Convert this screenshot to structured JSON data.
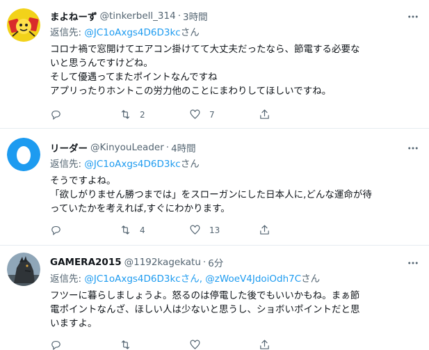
{
  "tweets": [
    {
      "display_name": "まよねーず",
      "handle": "@tinkerbell_314",
      "time": "3時間",
      "reply_prefix": "返信先: ",
      "reply_mentions": "@JC1oAxgs4D6D3kc",
      "reply_suffix": "さん",
      "lines": [
        "コロナ禍で窓開けてエアコン掛けてて大丈夫だったなら、節電する必要な",
        "いと思うんですけどね。",
        "そして優遇ってまたポイントなんですね",
        "アプリったりホントこの労力他のことにまわりしてほしいですね。"
      ],
      "replies": "",
      "retweets": "2",
      "likes": "7",
      "avatar_icon": "yellow-character-avatar-icon"
    },
    {
      "display_name": "リーダー",
      "handle": "@KinyouLeader",
      "time": "4時間",
      "reply_prefix": "返信先: ",
      "reply_mentions": "@JC1oAxgs4D6D3kc",
      "reply_suffix": "さん",
      "lines": [
        "そうですよね。",
        "「欲しがりません勝つまでは」をスローガンにした日本人に,どんな運命が待",
        "っていたかを考えれば,すぐにわかります。"
      ],
      "replies": "",
      "retweets": "4",
      "likes": "13",
      "avatar_icon": "default-egg-avatar-icon"
    },
    {
      "display_name": "GAMERA2015",
      "handle": "@1192kagekatu",
      "time": "6分",
      "reply_prefix": "返信先: ",
      "reply_mentions": "@JC1oAxgs4D6D3kcさん, @zWoeV4JdoiOdh7C",
      "reply_suffix": "さん",
      "lines": [
        "フツーに暮らしましょうよ。怒るのは停電した後でもいいかもね。まぁ節",
        "電ポイントなんざ、ほしい人は少ないと思うし、ショボいポイントだと思",
        "いますよ。"
      ],
      "replies": "",
      "retweets": "",
      "likes": "",
      "avatar_icon": "monster-avatar-icon"
    }
  ],
  "colors": {
    "link": "#1d9bf0",
    "muted": "#536471",
    "divider": "#e6ecf0"
  }
}
